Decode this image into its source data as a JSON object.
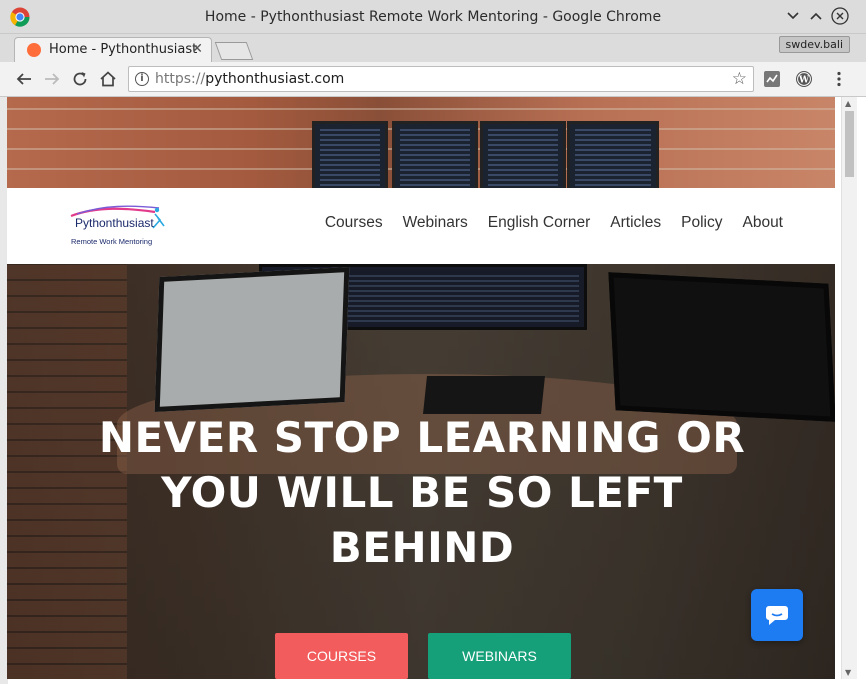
{
  "window": {
    "title": "Home - Pythonthusiast Remote Work Mentoring - Google Chrome",
    "controls": [
      "minimize",
      "maximize",
      "close"
    ]
  },
  "tab": {
    "title": "Home - Pythonthusiast Remote Work Mentoring",
    "close_glyph": "✕"
  },
  "profile_label": "swdev.bali",
  "address_bar": {
    "protocol": "https://",
    "host": "pythonthusiast.com"
  },
  "site": {
    "logo_title": "Pythonthusiast",
    "logo_subtitle": "Remote Work Mentoring",
    "nav": [
      "Courses",
      "Webinars",
      "English Corner",
      "Articles",
      "Policy",
      "About"
    ],
    "headline": "NEVER STOP LEARNING OR YOU WILL BE SO LEFT BEHIND",
    "buttons": {
      "courses": "COURSES",
      "webinars": "WEBINARS"
    }
  },
  "colors": {
    "courses_button": "#f25c5c",
    "webinars_button": "#16a07a",
    "chat_button": "#1e7cf2",
    "tab_favicon": "#ff6d3a"
  },
  "icons": [
    "chrome-icon",
    "back-icon",
    "forward-icon",
    "reload-icon",
    "home-icon",
    "info-icon",
    "star-icon",
    "chart-extension-icon",
    "wordpress-icon",
    "menu-icon",
    "chat-icon"
  ]
}
